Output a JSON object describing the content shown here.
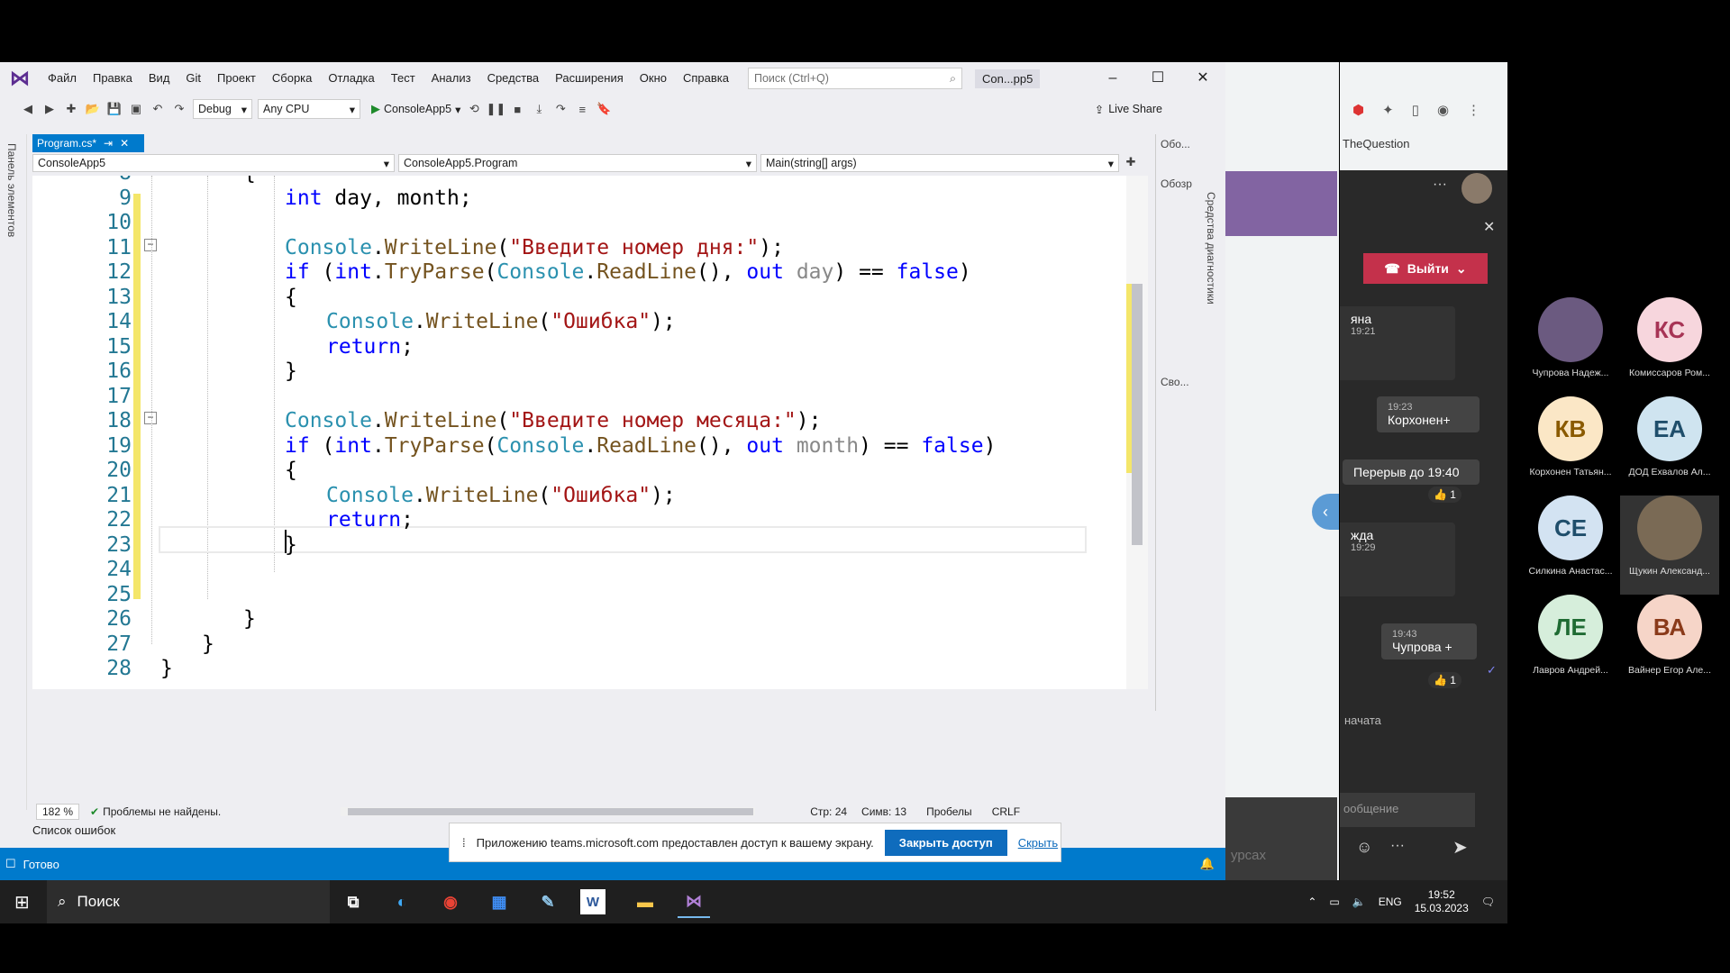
{
  "vs": {
    "menu": [
      "Файл",
      "Правка",
      "Вид",
      "Git",
      "Проект",
      "Сборка",
      "Отладка",
      "Тест",
      "Анализ",
      "Средства",
      "Расширения",
      "Окно",
      "Справка"
    ],
    "search_placeholder": "Поиск (Ctrl+Q)",
    "solution_name": "Con...pp5",
    "config": "Debug",
    "platform": "Any CPU",
    "run_label": "ConsoleApp5",
    "live_share": "Live Share",
    "left_panel": "Панель элементов",
    "doc_tab": "Program.cs*",
    "nav": {
      "project": "ConsoleApp5",
      "class": "ConsoleApp5.Program",
      "member": "Main(string[] args)"
    },
    "zoom": "182 %",
    "issues": "Проблемы не найдены.",
    "line_pos": "Стр: 24",
    "col_pos": "Симв: 13",
    "spaces": "Пробелы",
    "eol": "CRLF",
    "error_list": "Список ошибок",
    "status": "Готово",
    "right_panel": {
      "top": "Обо...",
      "overview": "Обозр",
      "props": "Сво...",
      "diag": "Средства диагностики"
    },
    "code": [
      {
        "n": "8",
        "t": "{"
      },
      {
        "n": "9",
        "t": "int day, month;"
      },
      {
        "n": "10",
        "t": ""
      },
      {
        "n": "11",
        "t": "Console.WriteLine(\"Введите номер дня:\");"
      },
      {
        "n": "12",
        "t": "if (int.TryParse(Console.ReadLine(), out day) == false)"
      },
      {
        "n": "13",
        "t": "{"
      },
      {
        "n": "14",
        "t": "Console.WriteLine(\"Ошибка\");"
      },
      {
        "n": "15",
        "t": "return;"
      },
      {
        "n": "16",
        "t": "}"
      },
      {
        "n": "17",
        "t": ""
      },
      {
        "n": "18",
        "t": "Console.WriteLine(\"Введите номер месяца:\");"
      },
      {
        "n": "19",
        "t": "if (int.TryParse(Console.ReadLine(), out month) == false)"
      },
      {
        "n": "20",
        "t": "{"
      },
      {
        "n": "21",
        "t": "Console.WriteLine(\"Ошибка\");"
      },
      {
        "n": "22",
        "t": "return;"
      },
      {
        "n": "23",
        "t": "}"
      },
      {
        "n": "24",
        "t": ""
      },
      {
        "n": "25",
        "t": ""
      },
      {
        "n": "26",
        "t": "}"
      },
      {
        "n": "27",
        "t": "}"
      },
      {
        "n": "28",
        "t": "}"
      }
    ]
  },
  "share_banner": {
    "text": "Приложению teams.microsoft.com предоставлен доступ к вашему экрану.",
    "close": "Закрыть доступ",
    "hide": "Скрыть"
  },
  "browser": {
    "bookmark": "TheQuestion",
    "footer_fragment": "урсах"
  },
  "teams": {
    "leave": "Выйти",
    "chat": [
      {
        "name": "яна",
        "time": "19:21"
      },
      {
        "time": "19:23",
        "text": "Корхонен+"
      },
      {
        "text": "Перерыв до 19:40",
        "reaction": "👍 1"
      },
      {
        "name": "жда",
        "time": "19:29"
      },
      {
        "time": "19:43",
        "text": "Чупрова +",
        "reaction": "👍 1"
      },
      {
        "text": "начата"
      }
    ],
    "input_placeholder": "ообщение",
    "participants": [
      {
        "initials": "",
        "name": "Чупрова Надеж...",
        "color": "#6b5a80"
      },
      {
        "initials": "КС",
        "name": "Комиссаров Ром...",
        "color": "#f7d6dd"
      },
      {
        "initials": "КВ",
        "name": "Корхонен Татьян...",
        "color": "#fbe7c6"
      },
      {
        "initials": "ЕА",
        "name": "ДОД Ехвалов Ал...",
        "color": "#cfe4f0"
      },
      {
        "initials": "СЕ",
        "name": "Силкина Анастас...",
        "color": "#d3e3f2"
      },
      {
        "initials": "",
        "name": "Щукин Александ...",
        "color": "#7a6a55"
      },
      {
        "initials": "ЛЕ",
        "name": "Лавров Андрей...",
        "color": "#d6eedb"
      },
      {
        "initials": "ВА",
        "name": "Вайнер Егор Але...",
        "color": "#f6d5c8"
      }
    ]
  },
  "taskbar": {
    "search": "Поиск",
    "lang": "ENG",
    "time": "19:52",
    "date": "15.03.2023"
  }
}
